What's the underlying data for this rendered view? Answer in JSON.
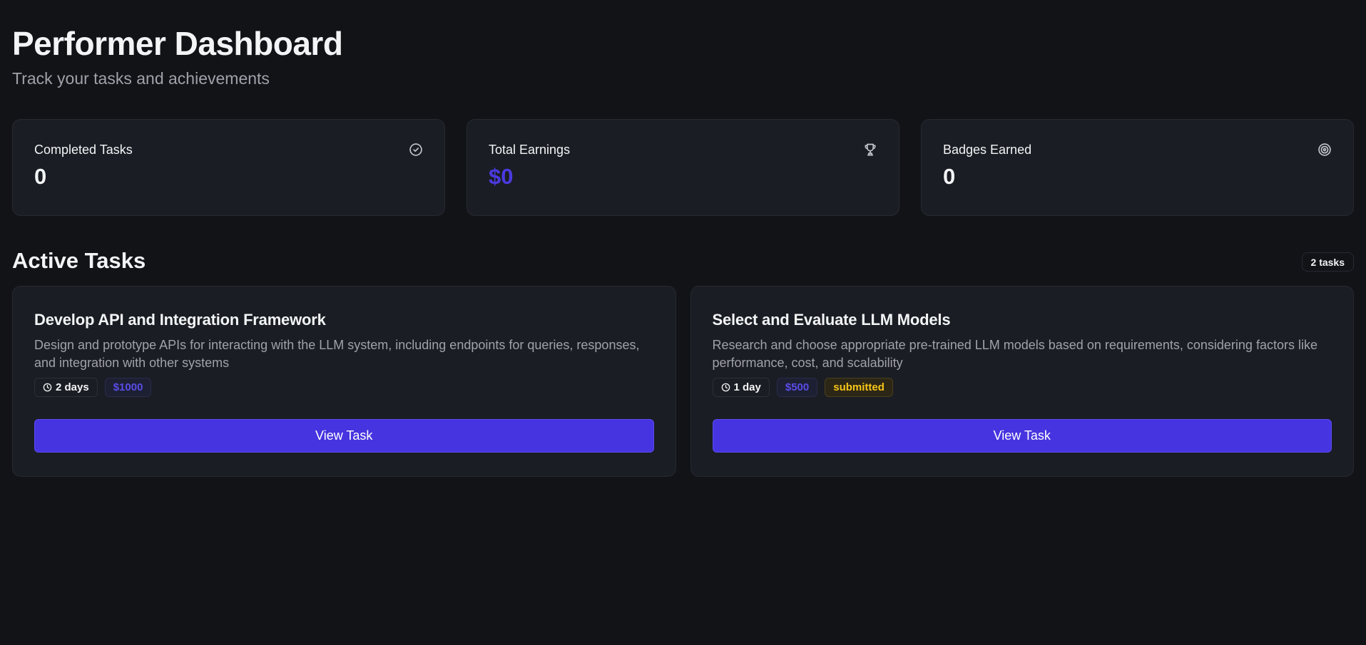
{
  "header": {
    "title": "Performer Dashboard",
    "subtitle": "Track your tasks and achievements"
  },
  "stats": [
    {
      "label": "Completed Tasks",
      "value": "0",
      "icon": "check-circle-icon"
    },
    {
      "label": "Total Earnings",
      "value": "$0",
      "icon": "trophy-icon",
      "value_color": "#4b3ae0"
    },
    {
      "label": "Badges Earned",
      "value": "0",
      "icon": "target-icon"
    }
  ],
  "active_tasks": {
    "title": "Active Tasks",
    "count_label": "2 tasks",
    "tasks": [
      {
        "title": "Develop API and Integration Framework",
        "description": "Design and prototype APIs for interacting with the LLM system, including endpoints for queries, responses, and integration with other systems",
        "duration": "2 days",
        "reward": "$1000",
        "button_label": "View Task"
      },
      {
        "title": "Select and Evaluate LLM Models",
        "description": "Research and choose appropriate pre-trained LLM models based on requirements, considering factors like performance, cost, and scalability",
        "duration": "1 day",
        "reward": "$500",
        "status": "submitted",
        "button_label": "View Task"
      }
    ]
  },
  "colors": {
    "background": "#111317",
    "card": "#1a1d23",
    "accent": "#4634e0",
    "status_submitted": "#f5c518"
  }
}
